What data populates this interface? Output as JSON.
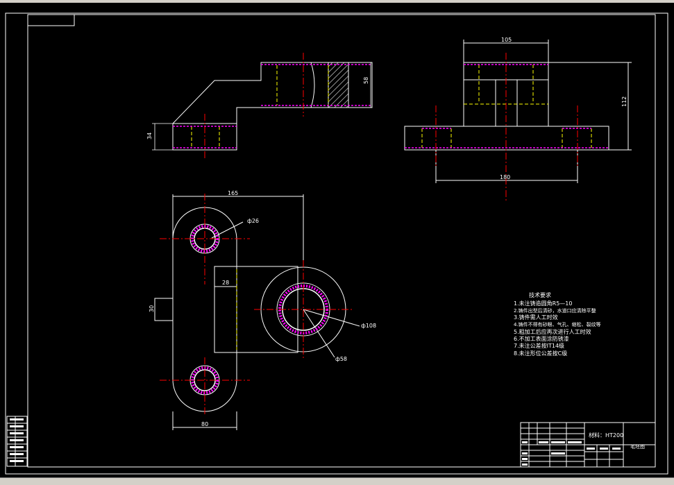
{
  "colors": {
    "background": "#000000",
    "outline": "#ffffff",
    "centerline": "#ff0000",
    "hidden": "#ffff00",
    "thread": "#ff00ff"
  },
  "dimensions": {
    "d105": "105",
    "d112": "112",
    "d180": "180",
    "d58": "58",
    "d34": "34",
    "d165": "165",
    "d80": "80",
    "d30": "30",
    "d28": "28",
    "phi26": "ф26",
    "phi108": "ф108",
    "phi58": "ф58"
  },
  "tech_requirements": {
    "title": "技术要求",
    "items": [
      "1.未注铸造圆角R5—10",
      "2.铸件出型后清砂，水道口应清除平整",
      "3.铸件需人工时效",
      "4.铸件不得有砂眼、气孔、缩松、裂纹等",
      "5.粗加工后应再次进行人工时效",
      "6.不加工表面涂防锈漆",
      "7.未注公差按IT14级",
      "8.未注形位公差按C级"
    ]
  },
  "title_block": {
    "material": "材料：HT200",
    "drawing_name": "毛坯图"
  }
}
